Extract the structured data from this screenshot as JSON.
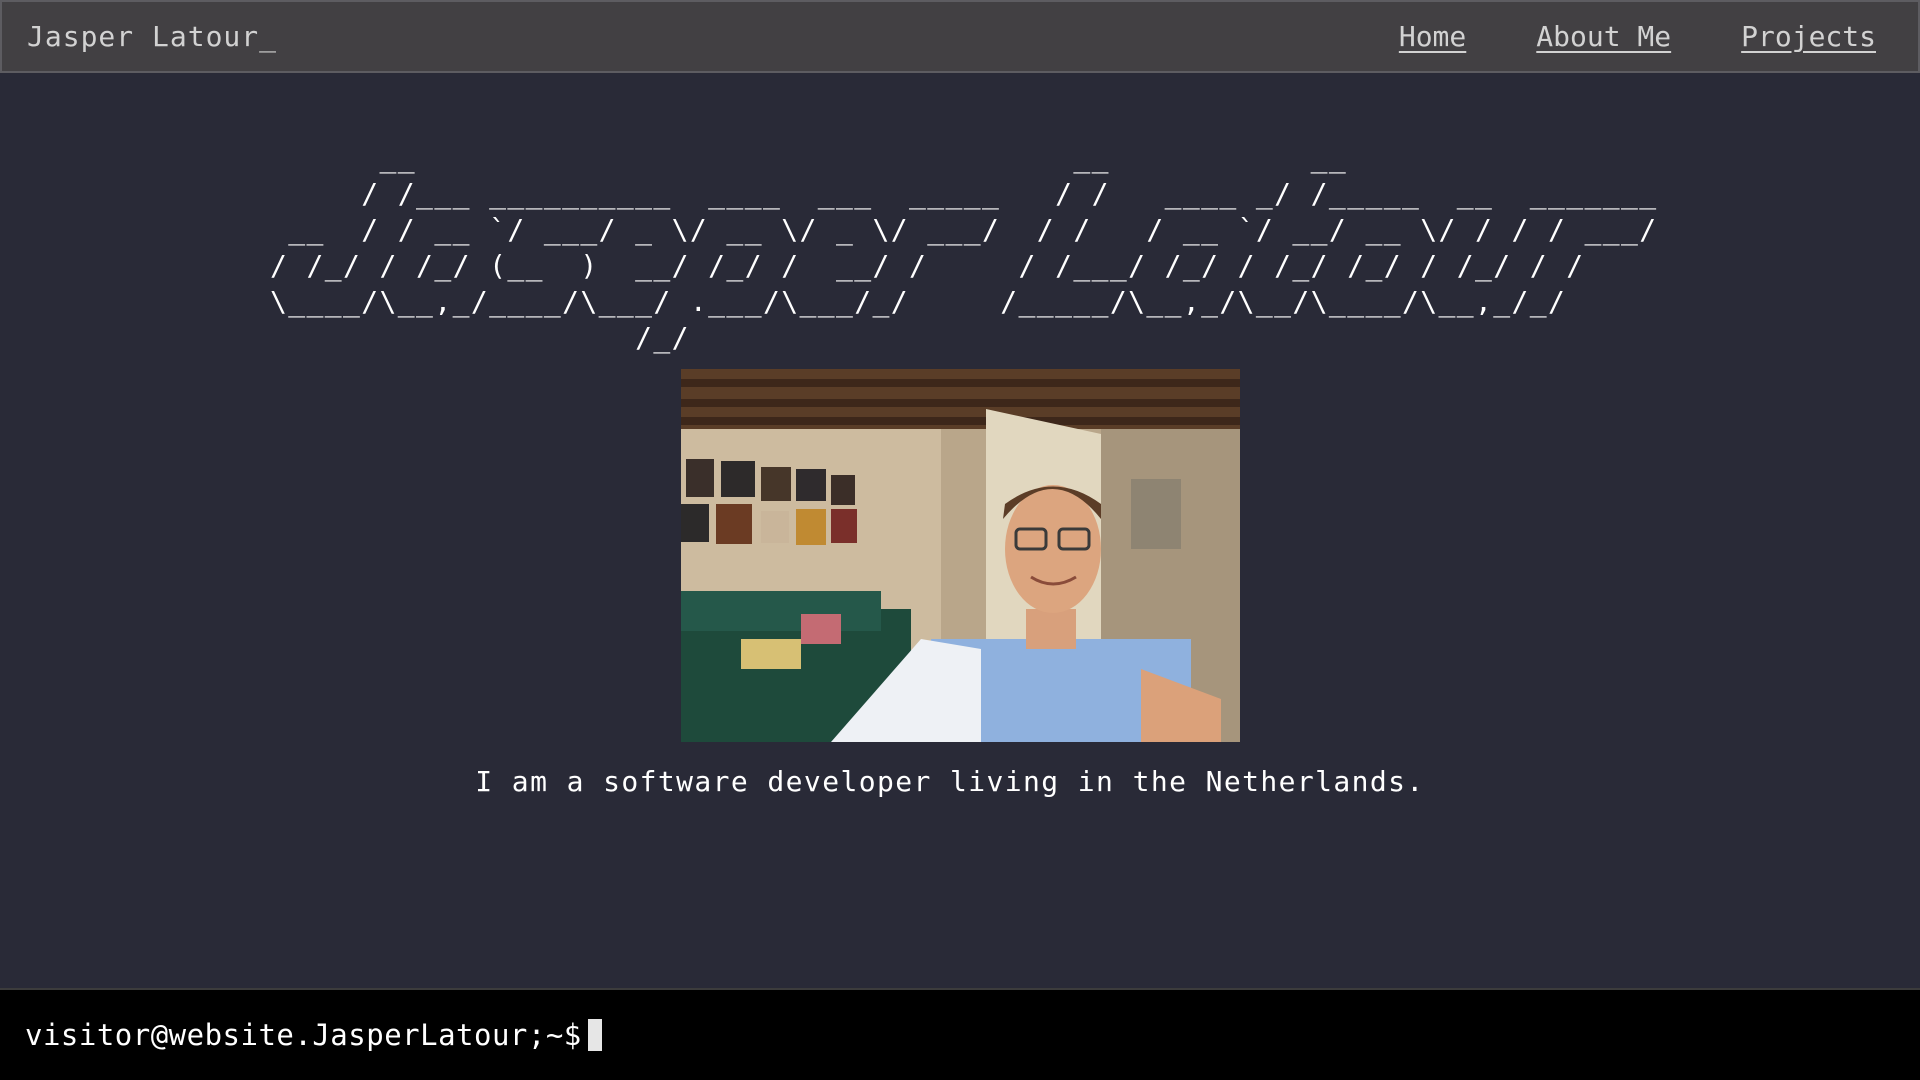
{
  "header": {
    "site_title": "Jasper Latour_",
    "nav": [
      {
        "label": "Home"
      },
      {
        "label": "About Me"
      },
      {
        "label": "Projects"
      }
    ]
  },
  "hero": {
    "ascii_art": "      __                                    __           __\n     / /___ __________  ____  ___  _____   / /   ____ _/ /_____  __  _______\n __  / / __ `/ ___/ _ \\/ __ \\/ _ \\/ ___/  / /   / __ `/ __/ __ \\/ / / / ___/\n/ /_/ / /_/ (__  )  __/ /_/ /  __/ /     / /___/ /_/ / /_/ /_/ / /_/ / /\n\\____/\\__,_/____/\\___/ .___/\\___/_/     /_____/\\__,_/\\__/\\____/\\__,_/_/\n                    /_/",
    "photo_alt": "Selfie of Jasper in his room",
    "tagline": "I am a software developer living in the Netherlands."
  },
  "terminal": {
    "prompt": "visitor@website.JasperLatour;~$"
  },
  "colors": {
    "background": "#292a37",
    "header_bg": "#424043",
    "terminal_bg": "#000000",
    "text": "#ffffff",
    "nav_text": "#d2d2d2"
  }
}
